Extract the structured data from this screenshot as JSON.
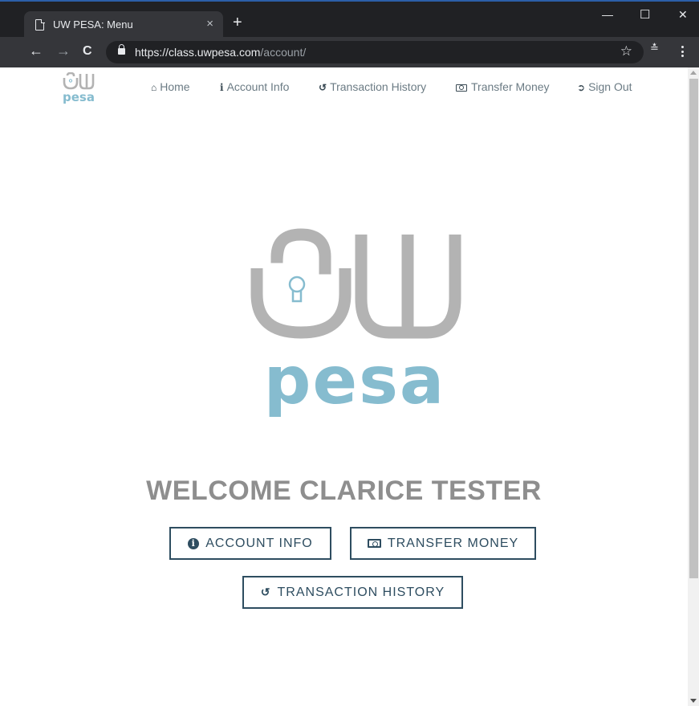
{
  "browser": {
    "tab_title": "UW PESA: Menu",
    "tab_close": "×",
    "new_tab": "+",
    "minimize": "—",
    "maximize": "☐",
    "close": "✕",
    "url_host": "https://class.uwpesa.com",
    "url_path": "/account/",
    "back": "←",
    "forward": "→",
    "reload": "C",
    "bookmark": "☆",
    "extension": "≛"
  },
  "nav": {
    "logo_text": "pesa",
    "items": [
      {
        "icon": "home-icon",
        "label": "Home"
      },
      {
        "icon": "info-icon",
        "label": "Account Info"
      },
      {
        "icon": "history-icon",
        "label": "Transaction History"
      },
      {
        "icon": "money-icon",
        "label": "Transfer Money"
      },
      {
        "icon": "sign-out-icon",
        "label": "Sign Out"
      }
    ]
  },
  "hero": {
    "logo_text": "pesa"
  },
  "welcome": "WELCOME CLARICE TESTER",
  "buttons": {
    "account_info": "ACCOUNT INFO",
    "transfer_money": "TRANSFER MONEY",
    "transaction_history": "TRANSACTION HISTORY"
  },
  "colors": {
    "brand_gray": "#b3b3b3",
    "brand_blue": "#86bccf",
    "button_border": "#2e4d60",
    "welcome_text": "#8e8e8e"
  }
}
